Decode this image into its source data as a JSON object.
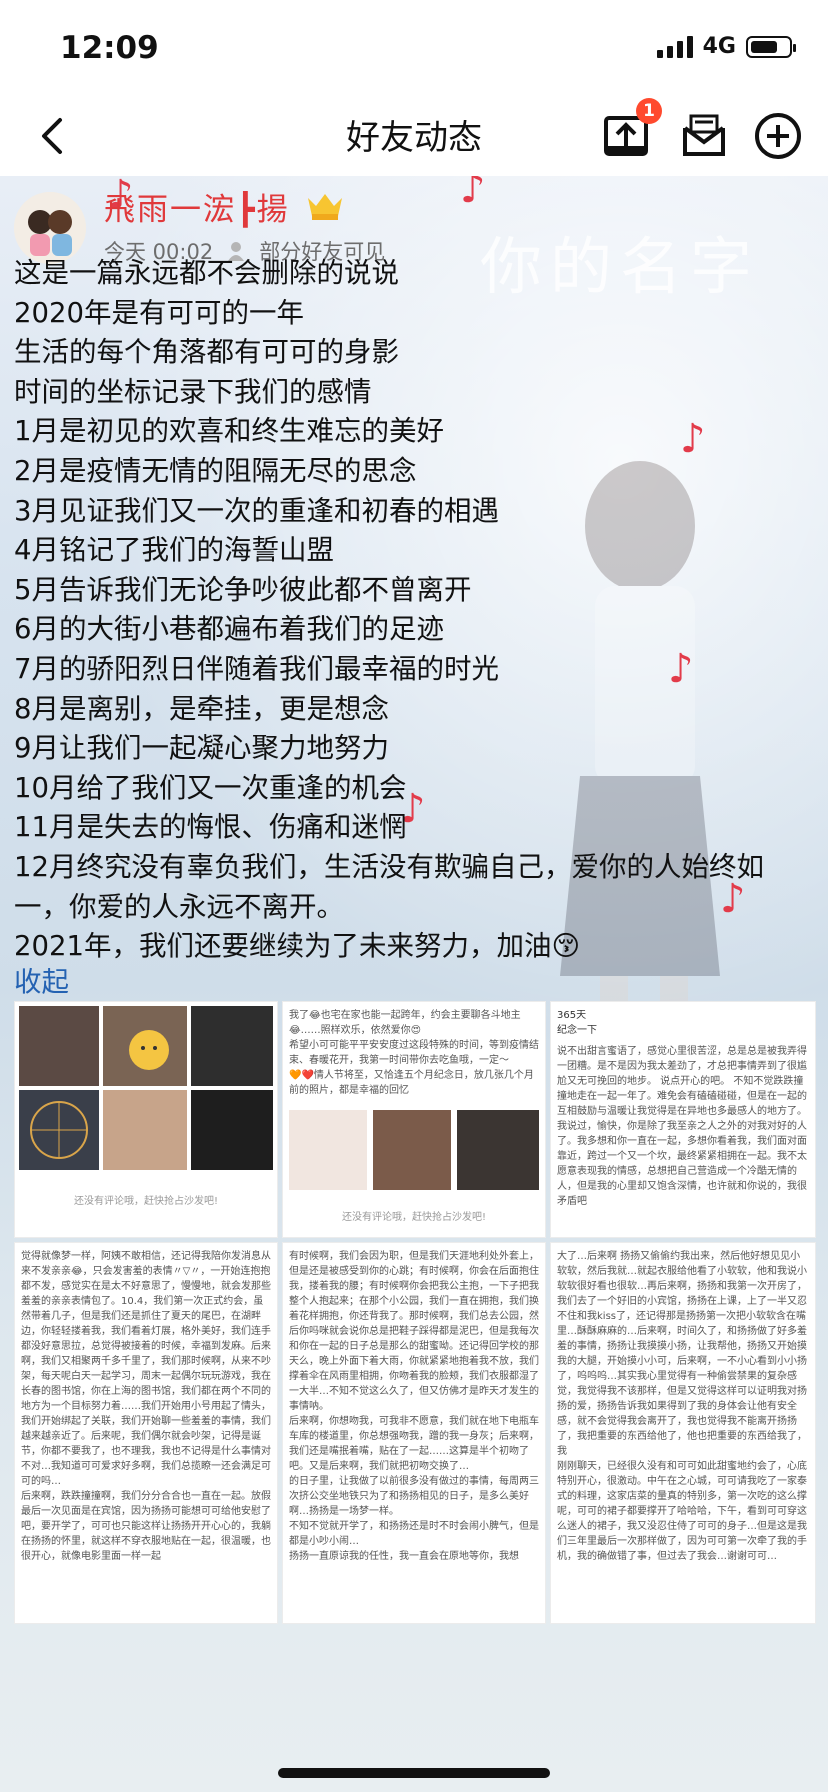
{
  "status_bar": {
    "time": "12:09",
    "network": "4G",
    "battery_level": 0.75
  },
  "nav": {
    "title": "好友动态",
    "upload_badge": "1",
    "back_icon": "chevron-left-icon",
    "upload_icon": "upload-tray-icon",
    "mail_icon": "mail-icon",
    "add_icon": "plus-circle-icon"
  },
  "post": {
    "author": "飛雨一浤┣揚",
    "vip_badge": "LV7",
    "time": "今天 00:02",
    "visibility": "部分好友可见",
    "lines": [
      "这是一篇永远都不会删除的说说",
      "2020年是有可可的一年",
      "生活的每个角落都有可可的身影",
      "时间的坐标记录下我们的感情",
      "1月是初见的欢喜和终生难忘的美好",
      "2月是疫情无情的阻隔无尽的思念",
      "3月见证我们又一次的重逢和初春的相遇",
      "4月铭记了我们的海誓山盟",
      "5月告诉我们无论争吵彼此都不曾离开",
      "6月的大街小巷都遍布着我们的足迹",
      "7月的骄阳烈日伴随着我们最幸福的时光",
      "8月是离别，是牵挂，更是想念",
      "9月让我们一起凝心聚力地努力",
      "10月给了我们又一次重逢的机会",
      "11月是失去的悔恨、伤痛和迷惘",
      "12月终究没有辜负我们，生活没有欺骗自己，爱你的人始终如一，你爱的人永远不离开。",
      "2021年，我们还要继续为了未来努力，加油😚"
    ],
    "collapse_label": "收起",
    "background_title": "你的名字"
  },
  "screenshots": {
    "no_comment_text": "还没有评论哦，赶快抢占沙发吧!",
    "shot2_text": "我了😂也宅在家也能一起跨年，约会主要聊各斗地主😂……照样欢乐，依然爱你😍\n希望小可可能平平安安度过这段特殊的时间，等到疫情结束、春暖花开，我第一时间带你去吃鱼哦，一定～\n🧡❤️情人节将至，又恰逢五个月纪念日，放几张几个月前的照片，都是幸福的回忆",
    "shot3_header": "365天\n纪念一下",
    "shot3_text": "说不出甜言蜜语了，感觉心里很苦涩，总是总是被我弄得一团糟。是不是因为我太差劲了，才总把事情弄到了很尴尬又无可挽回的地步。\n说点开心的吧。\n不知不觉跌跌撞撞地走在一起一年了。难免会有磕磕碰碰，但是在一起的互相鼓励与温暖让我觉得是在异地也多最感人的地方了。我说过，愉快，你是除了我至亲之人之外的对我对好的人了。我多想和你一直在一起，多想你看着我，我们面对面靠近，跨过一个又一个坎，最终紧紧相拥在一起。我不太愿意表现我的情感，总想把自己营造成一个冷酷无情的人，但是我的心里却又饱含深情，也许就和你说的，我很矛盾吧",
    "shot4_text": "觉得就像梦一样，阿姨不敢相信，还记得我陪你发消息从来不发亲亲😂，只会发害羞的表情〃▽〃，一开始连抱抱都不发，感觉实在是太不好意思了，慢慢地，就会发那些羞羞的亲亲表情包了。10.4，我们第一次正式约会，虽然带着几子，但是我们还是抓住了夏天的尾巴，在湖畔边，你轻轻搂着我，我们看着灯展，格外美好，我们连手都没好意思拉，总觉得被接着的时候，幸福到发麻。后来啊，我们又相聚两千多千里了，我们那时候啊，从来不吵架，每天呢白天一起学习，周末一起偶尔玩玩游戏，我在长春的图书馆，你在上海的图书馆，我们都在两个不同的地方为一个目标努力着……我们开始用小号用起了情头，我们开始绑起了关联，我们开始聊一些羞羞的事情，我们越来越亲近了。后来呢，我们偶尔就会吵架，记得是诞节，你都不要我了，也不理我，我也不记得是什么事情对不对…我知道可可爱求好多啊，我们总揽瞭一还会满足可可的吗…\n后来啊，跌跌撞撞啊，我们分分合合也一直在一起。放假最后一次见面是在宾馆，因为扬扬可能想可可给他安慰了吧，要开学了，可可也只能这样让扬扬开开心心的，我躺在扬扬的怀里，就这样不穿衣服地贴在一起，很温暖，也很开心，就像电影里面一样一起",
    "shot5_text": "有时候啊，我们会因为职，但是我们天涯地利处外套上，但是还是被感受到你的心跳；有时候啊，你会在后面抱住我，搂着我的腰；有时候啊你会把我公主抱，一下子把我整个人抱起来；在那个小公园，我们一直在拥抱，我们换着花样拥抱，你还背我了。那时候啊，我们总去公园，然后你吗咪就会说你总是把鞋子踩得都是泥巴，但是我每次和你在一起的日子总是那么的甜蜜呦。还记得回学校的那天么，晚上外面下着大雨，你就紧紧地抱着我不放，我们撑着伞在风雨里相拥，你吻着我的脸颊，我们衣服都湿了一大半…不知不觉这么久了，但又仿佛才是昨天才发生的事情呐。\n后来啊，你想吻我，可我非不愿意，我们就在地下电瓶车车库的楼道里，你总想强吻我，蹭的我一身灰；后来啊，我们还是嘴抿着嘴，贴在了一起……这算是半个初吻了吧。又是后来啊，我们就把初吻交换了…\n的日子里，让我做了以前很多没有做过的事情，每周两三次挤公交坐地铁只为了和扬扬相见的日子，是多么美好啊…扬扬是一场梦一样。\n不知不觉就开学了，和扬扬还是时不时会闹小脾气，但是都是小吵小闹…\n扬扬一直原谅我的任性，我一直会在原地等你，我想",
    "shot6_text": "大了…后来啊 扬扬又偷偷约我出来，然后他好想见见小软软，然后我就…就起衣服给他看了小软软，他和我说小软软很好看也很软…再后来啊，扬扬和我第一次开房了，我们去了一个好旧的小宾馆，扬扬在上课，上了一半又忍不住和我kiss了，还记得那是扬扬第一次把小软软含在嘴里…酥酥麻麻的…后来啊，时间久了，和扬扬做了好多羞羞的事情，扬扬让我摸摸小扬，让我帮他，扬扬又开始摸我的大腿，开始摸小小可，后来啊，一不小心看到小小扬了，呜呜呜…其实我心里觉得有一种偷尝禁果的复杂感觉，我觉得我不该那样，但是又觉得这样可以证明我对扬扬的爱，扬扬告诉我如果得到了我的身体会让他有安全感，就不会觉得我会离开了，我也觉得我不能离开扬扬了，我把重要的东西给他了，他也把重要的东西给我了，我\n刚刚聊天，已经很久没有和可可如此甜蜜地约会了，心底特别开心，很激动。中午在之心城，可可请我吃了一家泰式的料理，这家店菜的量真的特别多，第一次吃的这么撑呢，可可的裙子都要撑开了哈哈哈，下午，看到可可穿这么迷人的裙子，我又没忍住侍了可可的身子…但是这是我们三年里最后一次那样做了，因为可可第一次牵了我的手机，我的确做错了事，但过去了我会…谢谢可可…"
  }
}
